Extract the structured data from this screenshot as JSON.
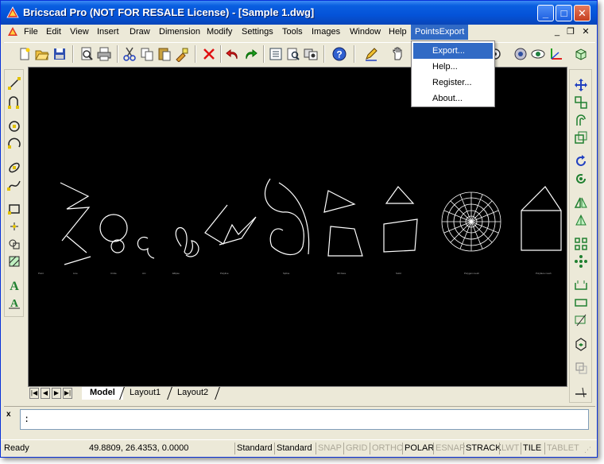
{
  "window": {
    "title": "Bricscad Pro (NOT FOR RESALE License) - [Sample 1.dwg]",
    "controls": {
      "minimize": "_",
      "maximize": "□",
      "close": "✕"
    },
    "mdi_controls": {
      "minimize": "_",
      "restore": "❐",
      "close": "✕"
    }
  },
  "menu": {
    "items": [
      "File",
      "Edit",
      "View",
      "Insert",
      "Draw",
      "Dimension",
      "Modify",
      "Settings",
      "Tools",
      "Images",
      "Window",
      "Help",
      "PointsExport"
    ],
    "active": "PointsExport"
  },
  "dropdown": {
    "items": [
      "Export...",
      "Help...",
      "Register...",
      "About..."
    ],
    "highlighted": "Export..."
  },
  "toolbar": {
    "icons": [
      "new-icon",
      "open-icon",
      "save-icon",
      "print-preview-icon",
      "print-icon",
      "cut-icon",
      "copy-icon",
      "paste-icon",
      "match-properties-icon",
      "delete-icon",
      "undo-icon",
      "redo-icon",
      "properties-icon",
      "explorer-icon",
      "design-center-icon",
      "help-icon",
      "pencil-icon",
      "pan-icon",
      "zoom-icon",
      "orbit-icon",
      "eye-icon",
      "axis-icon",
      "3d-box-icon"
    ]
  },
  "drawing": {
    "background": "#000000",
    "stroke": "#ffffff",
    "labels": [
      "Point",
      "Line",
      "Circle",
      "Arc",
      "Ellipse",
      "Polyline",
      "Spline",
      "3D Face",
      "Solid",
      "Polygon mesh",
      "Polyface mesh"
    ]
  },
  "layout_tabs": {
    "nav": [
      "|◀",
      "◀",
      "▶",
      "▶|"
    ],
    "tabs": [
      "Model",
      "Layout1",
      "Layout2"
    ],
    "active": "Model"
  },
  "command_line": {
    "close": "x",
    "prompt": ":"
  },
  "status": {
    "ready": "Ready",
    "coords": "49.8809, 26.4353, 0.0000",
    "text_style": "Standard",
    "dim_style": "Standard",
    "toggles": [
      {
        "label": "SNAP",
        "on": false
      },
      {
        "label": "GRID",
        "on": false
      },
      {
        "label": "ORTHO",
        "on": false
      },
      {
        "label": "POLAR",
        "on": true
      },
      {
        "label": "ESNAP",
        "on": false
      },
      {
        "label": "STRACK",
        "on": true
      },
      {
        "label": "LWT",
        "on": false
      },
      {
        "label": "TILE",
        "on": true
      },
      {
        "label": "TABLET",
        "on": false
      }
    ]
  },
  "colors": {
    "titlebar": "#0453d8",
    "menu_highlight": "#316ac5",
    "chrome": "#ece9d8"
  }
}
